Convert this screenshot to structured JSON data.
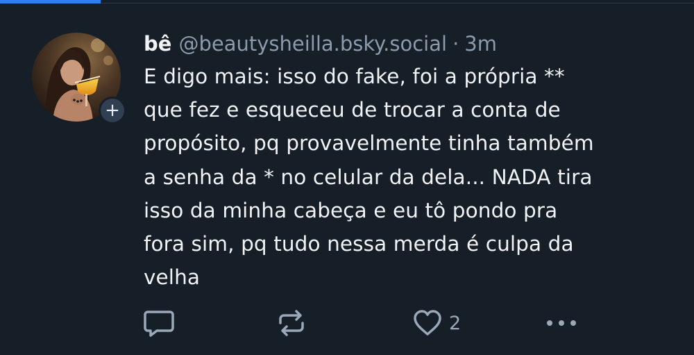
{
  "post": {
    "author": {
      "display_name": "bê",
      "handle": "@beautysheilla.bsky.social",
      "avatar_alt": "avatar"
    },
    "separator": "·",
    "timestamp": "3m",
    "text": "E digo mais: isso do fake, foi a própria **\nque fez e esqueceu de trocar a conta de\npropósito, pq provavelmente tinha também\na senha da * no celular da dela... NADA tira\nisso da minha cabeça e eu tô pondo pra\nfora sim, pq tudo nessa merda é culpa da\nvelha",
    "follow_icon": "plus-icon",
    "actions": {
      "reply_icon": "reply-icon",
      "repost_icon": "repost-icon",
      "like_icon": "heart-icon",
      "like_count": "2",
      "more_icon": "more-horizontal-icon"
    }
  },
  "colors": {
    "background": "#161e27",
    "text_primary": "#f1f3f5",
    "text_secondary": "#8c9bac",
    "accent": "#2f7ff2"
  }
}
